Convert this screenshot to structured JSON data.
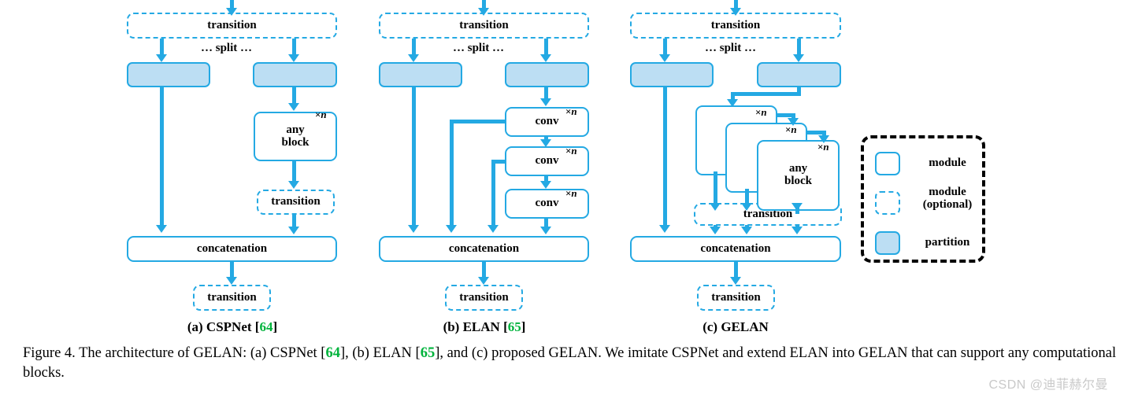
{
  "figure": {
    "caption_prefix": "Figure 4.",
    "caption_part1": " The architecture of GELAN: (a) CSPNet [",
    "caption_ref1": "64",
    "caption_part2": "], (b) ELAN [",
    "caption_ref2": "65",
    "caption_part3": "], and (c) proposed GELAN. We imitate CSPNet and extend ELAN into GELAN that can support any computational blocks."
  },
  "watermark": "CSDN @迪菲赫尔曼",
  "labels": {
    "transition": "transition",
    "split": "… split …",
    "concatenation": "concatenation",
    "any_block_line1": "any",
    "any_block_line2": "block",
    "conv": "conv",
    "times_n": "×n"
  },
  "subcaptions": [
    {
      "prefix": "(a) CSPNet ",
      "bracket_open": "[",
      "ref": "64",
      "bracket_close": "]"
    },
    {
      "prefix": "(b) ELAN ",
      "bracket_open": "[",
      "ref": "65",
      "bracket_close": "]"
    },
    {
      "prefix": "(c) GELAN",
      "bracket_open": "",
      "ref": "",
      "bracket_close": ""
    }
  ],
  "legend": {
    "rows": [
      {
        "label": "module",
        "style": "solid"
      },
      {
        "label": "module\n(optional)",
        "label_line1": "module",
        "label_line2": "(optional)",
        "style": "dashed"
      },
      {
        "label": "partition",
        "style": "filled"
      }
    ]
  },
  "colors": {
    "accent_blue": "#24a9e3",
    "partition_fill": "#bcdef3",
    "reference_green": "#00b33c",
    "legend_border": "#000000",
    "watermark_gray": "#c9c9c9"
  },
  "panels": {
    "cspnet": {
      "title": "(a) CSPNet",
      "nodes": [
        "transition",
        "… split …",
        "partition-left",
        "partition-right",
        "any block ×n",
        "transition",
        "concatenation",
        "transition"
      ]
    },
    "elan": {
      "title": "(b) ELAN",
      "nodes": [
        "transition",
        "… split …",
        "partition-left",
        "partition-right",
        "conv ×n",
        "conv ×n",
        "conv ×n",
        "concatenation",
        "transition"
      ]
    },
    "gelan": {
      "title": "(c) GELAN",
      "nodes": [
        "transition",
        "… split …",
        "partition-left",
        "partition-right",
        "any block ×n",
        "any block ×n",
        "any block ×n",
        "transition",
        "concatenation",
        "transition"
      ]
    }
  }
}
